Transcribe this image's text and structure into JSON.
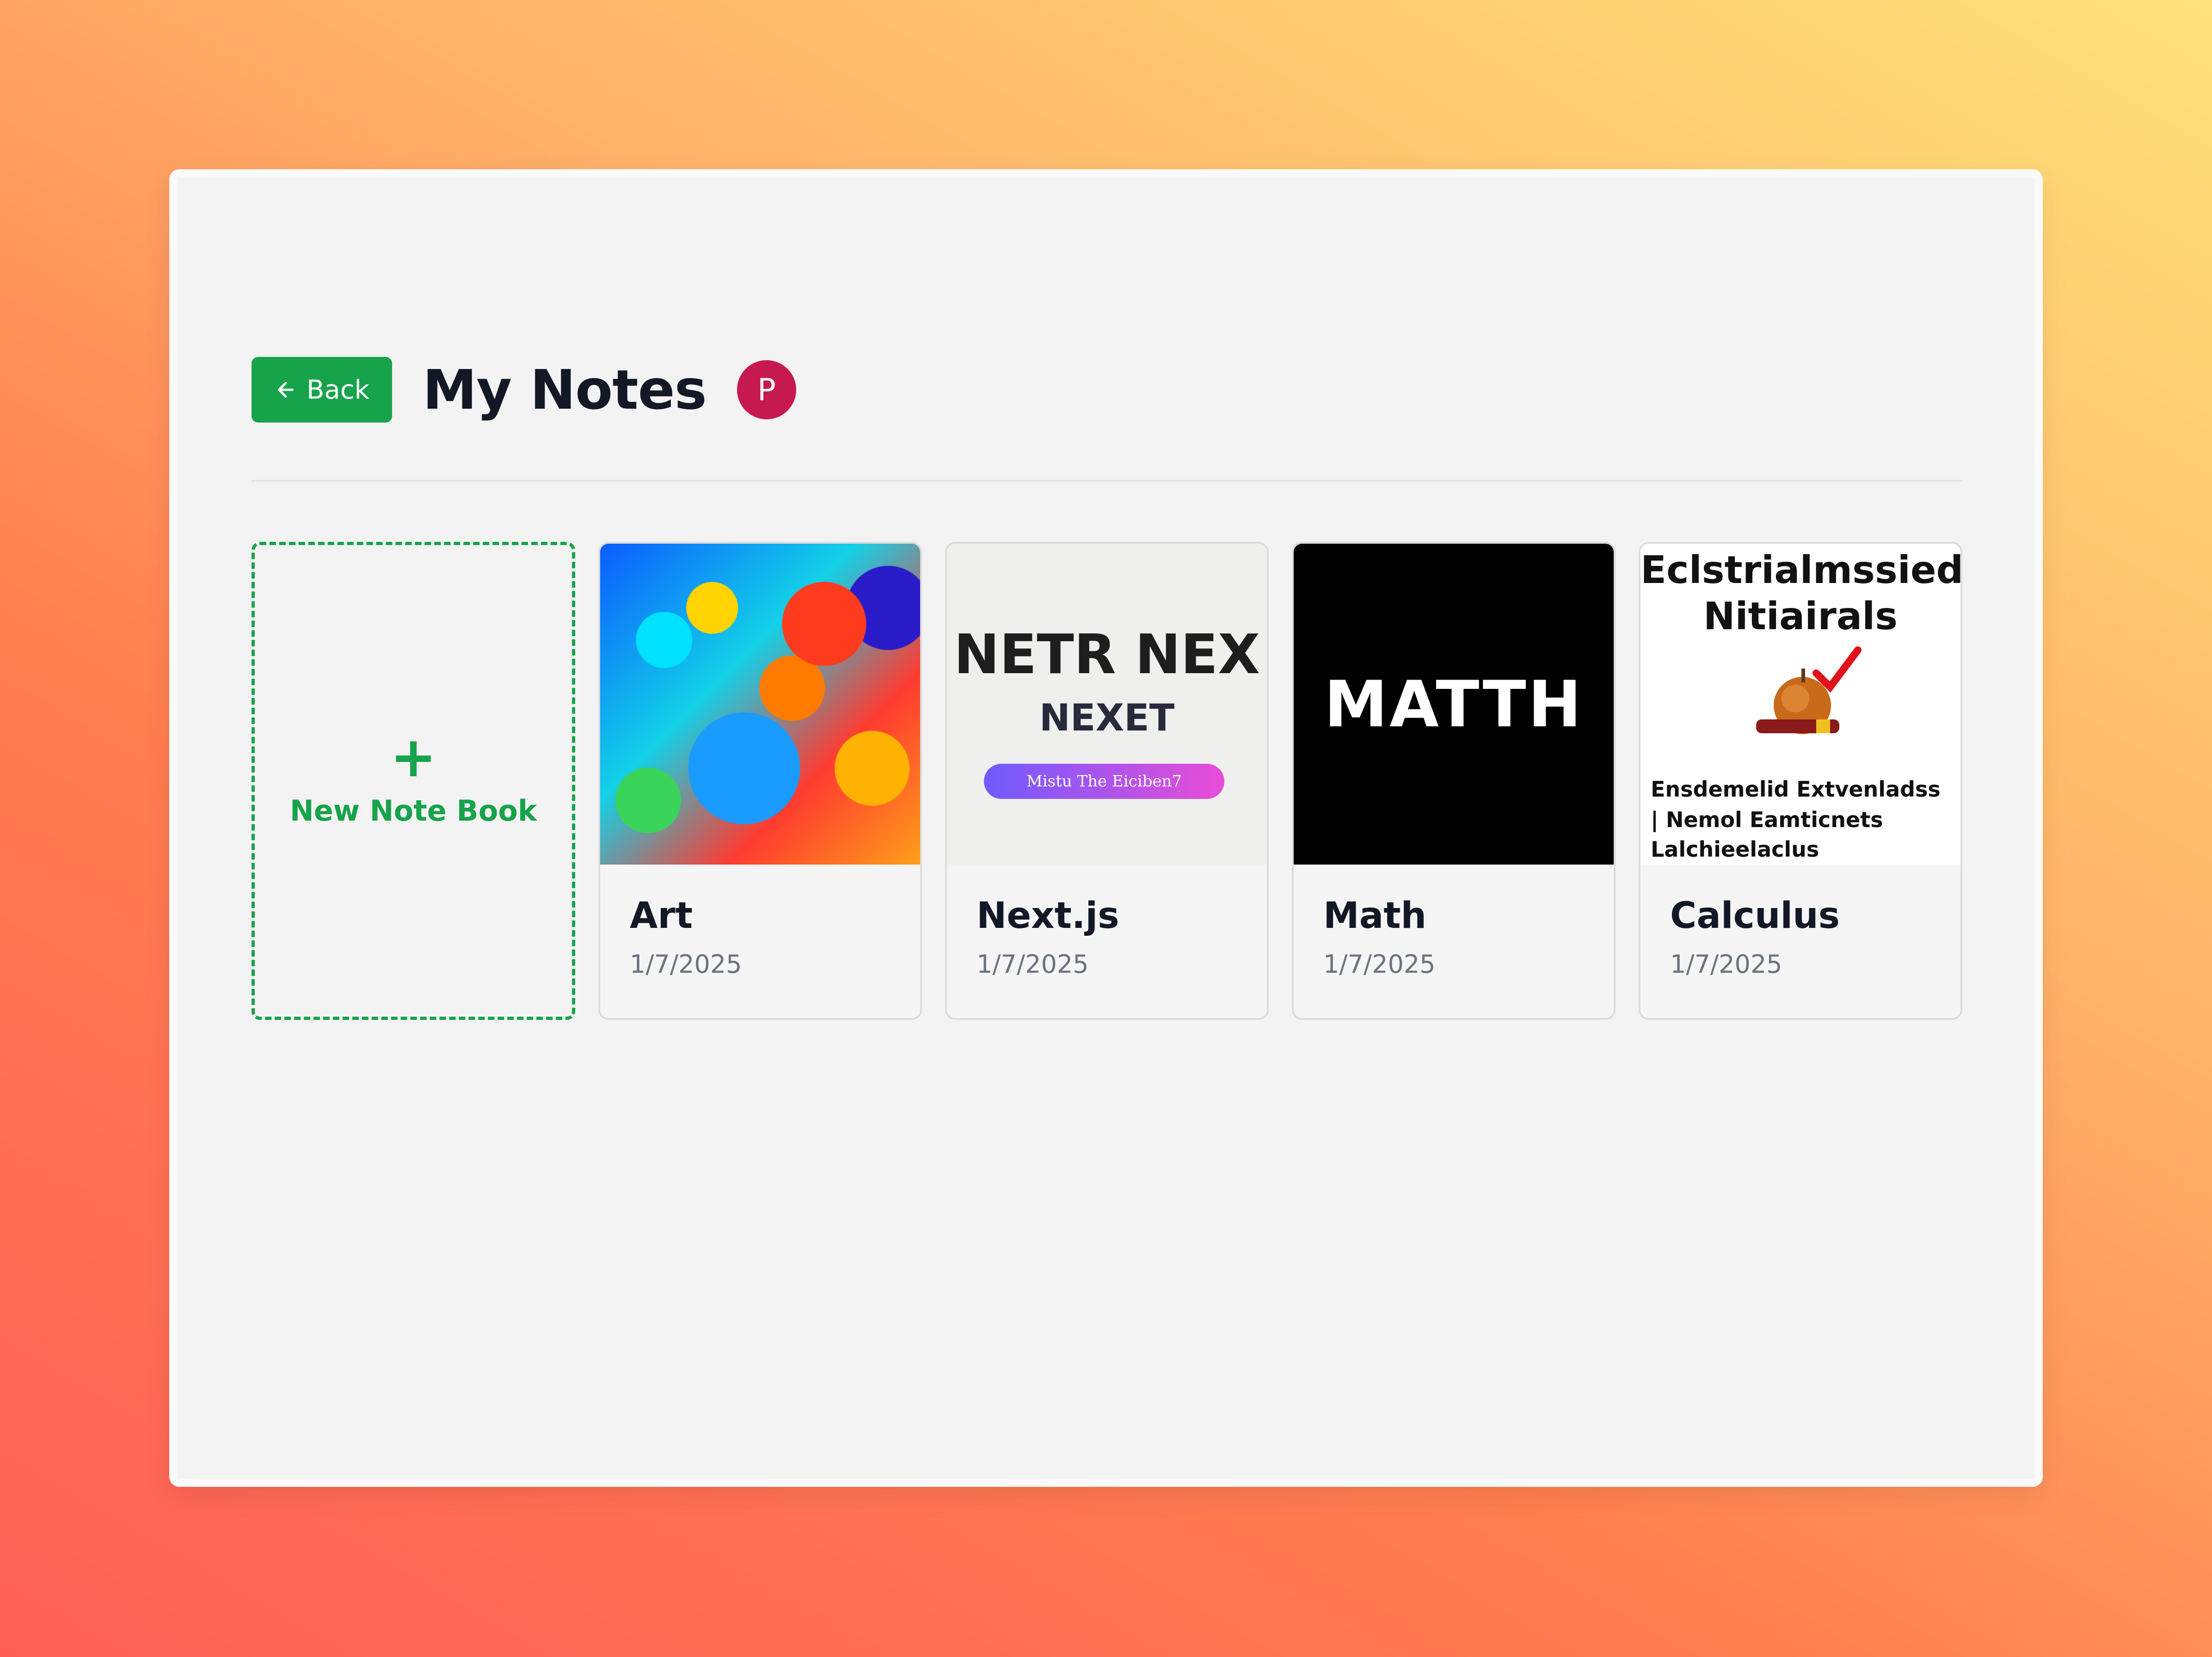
{
  "header": {
    "back_label": "Back",
    "title": "My Notes",
    "avatar_initial": "P"
  },
  "new_notebook": {
    "plus": "+",
    "label": "New Note Book"
  },
  "notebooks": [
    {
      "title": "Art",
      "date": "1/7/2025"
    },
    {
      "title": "Next.js",
      "date": "1/7/2025",
      "thumb": {
        "line1": "NETR NEX",
        "line2": "NEXET",
        "pill": "Mistu The Eiciben7"
      }
    },
    {
      "title": "Math",
      "date": "1/7/2025",
      "thumb": {
        "text": "MATTH"
      }
    },
    {
      "title": "Calculus",
      "date": "1/7/2025",
      "thumb": {
        "line1": "Eclstrialmssieds",
        "line2": "Nitiairals",
        "line3": "Ensdemelid Extvenladss",
        "line4": "| Nemol Eamticnets",
        "line5": "Lalchieelaclus"
      }
    }
  ],
  "colors": {
    "accent": "#16a34a",
    "avatar": "#c6194f",
    "text": "#121826",
    "muted": "#6b7280"
  }
}
